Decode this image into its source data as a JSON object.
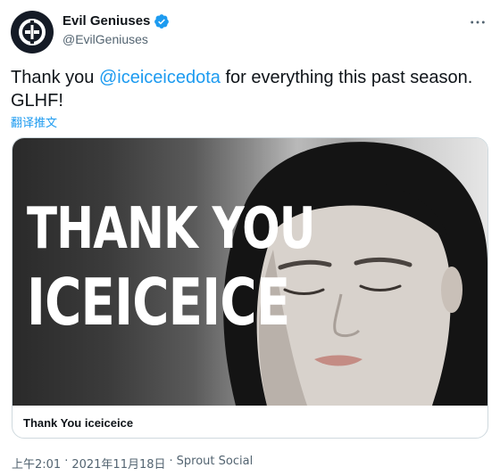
{
  "author": {
    "display_name": "Evil Geniuses",
    "handle": "@EvilGeniuses",
    "avatar_icon": "evil-geniuses-logo-icon",
    "verified_icon": "verified-badge-icon"
  },
  "more_icon": "more-options-icon",
  "tweet": {
    "text_before": "Thank you ",
    "mention": "@iceiceicedota",
    "text_after": " for everything this past season. GLHF!",
    "translate_label": "翻译推文"
  },
  "card": {
    "overlay_line1": "THANK YOU",
    "overlay_line2": "ICEICEICE",
    "title": "Thank You iceiceice"
  },
  "meta": {
    "time": "上午2:01",
    "sep1": "·",
    "date": "2021年11月18日",
    "sep2": "·",
    "source": "Sprout Social"
  },
  "colors": {
    "accent": "#1d9bf0",
    "text": "#0f1419",
    "secondary": "#536471",
    "border": "#cfd9de"
  }
}
